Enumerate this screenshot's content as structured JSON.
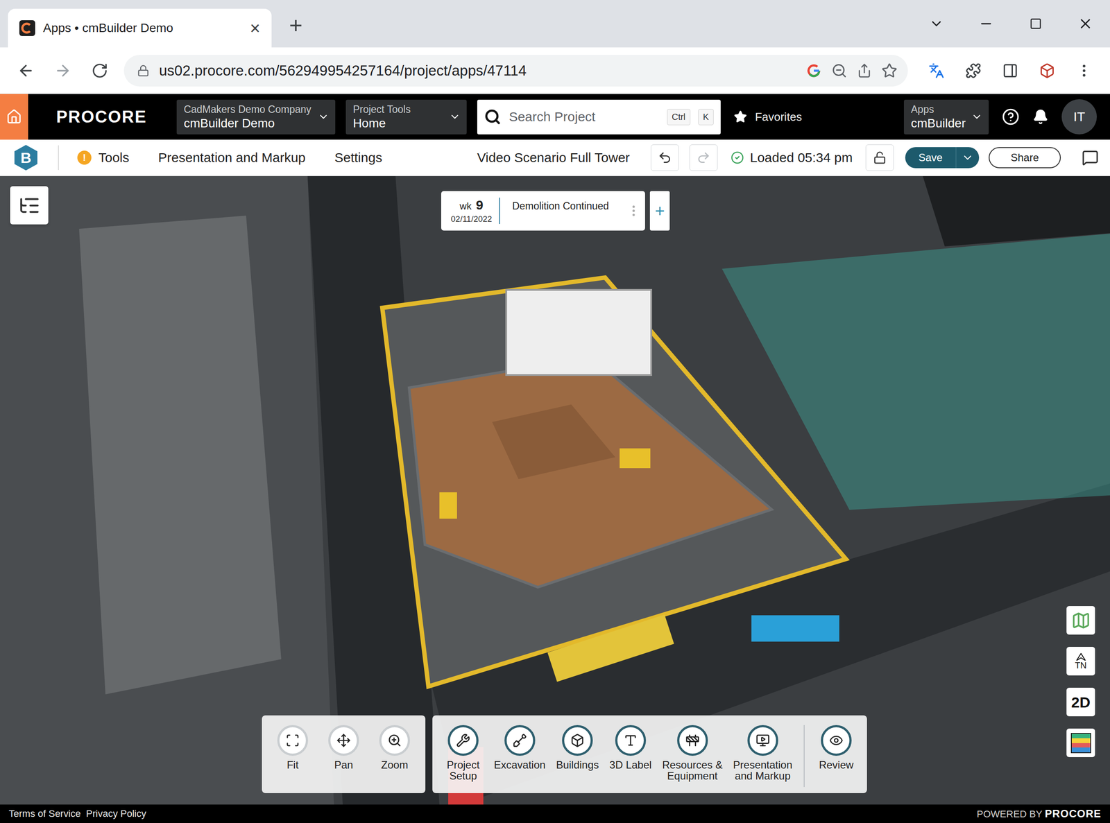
{
  "browser": {
    "tab": {
      "title": "Apps • cmBuilder Demo",
      "close": "×"
    },
    "new_tab": "+",
    "url": "us02.procore.com/562949954257164/project/apps/47114"
  },
  "header": {
    "logo": "PROCORE",
    "company": {
      "label": "CadMakers Demo Company",
      "value": "cmBuilder Demo"
    },
    "tools": {
      "label": "Project Tools",
      "value": "Home"
    },
    "search": {
      "placeholder": "Search Project",
      "keys": [
        "Ctrl",
        "K"
      ]
    },
    "favorites": "Favorites",
    "apps": {
      "label": "Apps",
      "value": "cmBuilder"
    },
    "avatar": "IT"
  },
  "toolbar": {
    "logo": "B",
    "warning_glyph": "!",
    "menu": [
      {
        "label": "Tools",
        "warning": true
      },
      {
        "label": "Presentation and Markup",
        "warning": false
      },
      {
        "label": "Settings",
        "warning": false
      }
    ],
    "title": "Video Scenario Full Tower",
    "undo_disabled": false,
    "redo_disabled": true,
    "status": "Loaded 05:34 pm",
    "save": "Save",
    "share": "Share"
  },
  "timeline": {
    "week_label": "wk",
    "week": "9",
    "date": "02/11/2022",
    "phase": "Demolition Continued",
    "add": "+"
  },
  "view_buttons": [
    {
      "label_lines": [
        "Fit"
      ]
    },
    {
      "label_lines": [
        "Pan"
      ]
    },
    {
      "label_lines": [
        "Zoom"
      ]
    }
  ],
  "tools": [
    {
      "label_lines": [
        "Project",
        "Setup"
      ]
    },
    {
      "label_lines": [
        "Excavation"
      ]
    },
    {
      "label_lines": [
        "Buildings"
      ]
    },
    {
      "label_lines": [
        "3D Label"
      ]
    },
    {
      "label_lines": [
        "Resources &",
        "Equipment"
      ]
    },
    {
      "label_lines": [
        "Presentation",
        "and Markup"
      ]
    },
    {
      "label_lines": [
        "Review"
      ]
    }
  ],
  "side_buttons": [
    {
      "kind": "map"
    },
    {
      "kind": "north",
      "label": "TN"
    },
    {
      "kind": "text",
      "label": "2D"
    },
    {
      "kind": "layers"
    }
  ],
  "footer": {
    "links": [
      "Terms of Service",
      "Privacy Policy"
    ],
    "powered_by": "POWERED BY",
    "brand": "PROCORE"
  }
}
